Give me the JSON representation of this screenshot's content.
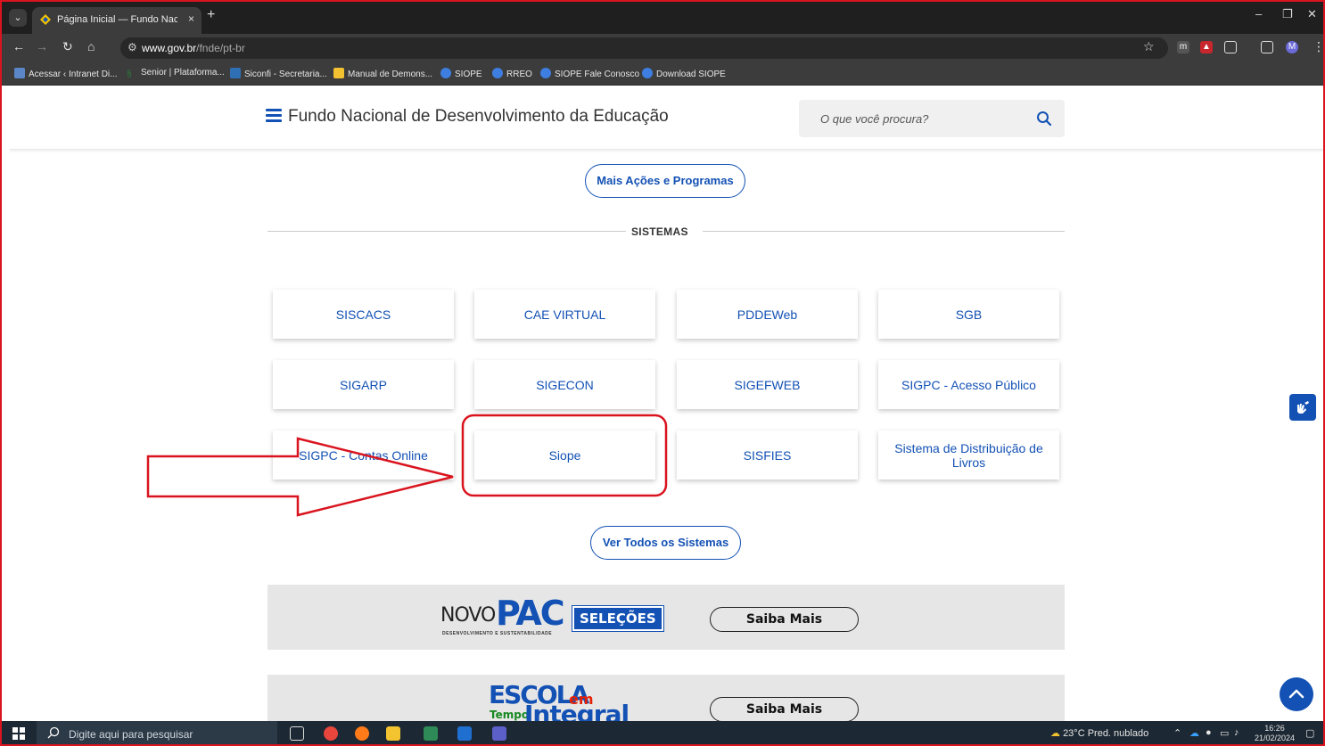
{
  "browser": {
    "tab_title": "Página Inicial — Fundo Nacional",
    "tab_close": "×",
    "new_tab": "+",
    "url_host": "www.gov.br",
    "url_path": "/fnde/pt-br",
    "window_controls": {
      "minimize": "–",
      "restore": "❐",
      "close": "✕"
    }
  },
  "bookmarks": [
    {
      "label": "Acessar ‹ Intranet Di...",
      "color": "#5b87c9"
    },
    {
      "label": "Senior | Plataforma...",
      "color": "#2d7d3a"
    },
    {
      "label": "Siconfi - Secretaria...",
      "color": "#2f6fb3"
    },
    {
      "label": "Manual de Demons...",
      "color": "#f2c230"
    },
    {
      "label": "SIOPE",
      "color": "#3d7ee0"
    },
    {
      "label": "RREO",
      "color": "#3d7ee0"
    },
    {
      "label": "SIOPE Fale Conosco",
      "color": "#3d7ee0"
    },
    {
      "label": "Download SIOPE",
      "color": "#3d7ee0"
    }
  ],
  "header": {
    "title": "Fundo Nacional de Desenvolvimento da Educação",
    "search_placeholder": "O que você procura?"
  },
  "mais_acoes": "Mais Ações e Programas",
  "section_title": "SISTEMAS",
  "systems": [
    [
      "SISCACS",
      "CAE VIRTUAL",
      "PDDEWeb",
      "SGB"
    ],
    [
      "SIGARP",
      "SIGECON",
      "SIGEFWEB",
      "SIGPC - Acesso Público"
    ],
    [
      "SIGPC - Contas Online",
      "Siope",
      "SISFIES",
      "Sistema de Distribuição de Livros"
    ]
  ],
  "ver_todos": "Ver Todos os Sistemas",
  "banners": [
    {
      "logo_novo": "NOVO",
      "logo_pac": "PAC",
      "logo_badge": "SELEÇÕES",
      "logo_sub": "DESENVOLVIMENTO E SUSTENTABILIDADE",
      "button": "Saiba Mais"
    },
    {
      "logo_escola": "ESCOLA",
      "logo_em": "em",
      "logo_tempo": "Tempo",
      "logo_integral": "Integral",
      "button": "Saiba Mais"
    }
  ],
  "taskbar": {
    "search_placeholder": "Digite aqui para pesquisar",
    "weather": "23°C  Pred. nublado",
    "time": "16:26",
    "date": "21/02/2024"
  },
  "colors": {
    "gov_blue": "#1351b4",
    "annotation_red": "#d9141e"
  }
}
